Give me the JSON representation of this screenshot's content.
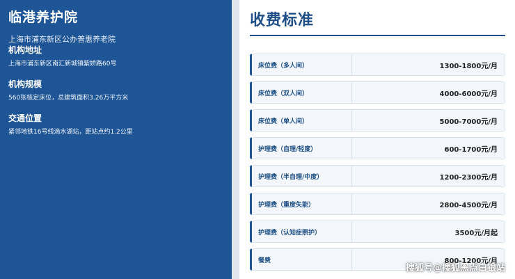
{
  "left": {
    "name": "临港养护院",
    "subtitle": "上海市浦东新区公办普惠养老院",
    "sections": [
      {
        "title": "机构地址",
        "text": "上海市浦东新区南汇新城镇紫娇路60号"
      },
      {
        "title": "机构规模",
        "text": "560张核定床位，总建筑面积3.26万平方米"
      },
      {
        "title": "交通位置",
        "text": "紧邻地铁16号线滴水湖站，距站点约1.2公里"
      }
    ]
  },
  "right": {
    "title": "收费标准",
    "fees": [
      {
        "name": "床位费（多人间）",
        "price": "1300-1800元/月"
      },
      {
        "name": "床位费（双人间）",
        "price": "4000-6000元/月"
      },
      {
        "name": "床位费（单人间）",
        "price": "5000-7000元/月"
      },
      {
        "name": "护理费（自理/轻度）",
        "price": "600-1700元/月"
      },
      {
        "name": "护理费（半自理/中度）",
        "price": "1200-2300元/月"
      },
      {
        "name": "护理费（重度失能）",
        "price": "2800-4500元/月"
      },
      {
        "name": "护理费（认知症照护）",
        "price": "3500元/月起"
      },
      {
        "name": "餐费",
        "price": "800-1200元/月"
      }
    ]
  },
  "watermark": "搜狐号@搜狐黑点白银站",
  "colors": {
    "primary": "#1e5596",
    "title": "#1e4f86",
    "row_bg": "#f3f7fb"
  }
}
